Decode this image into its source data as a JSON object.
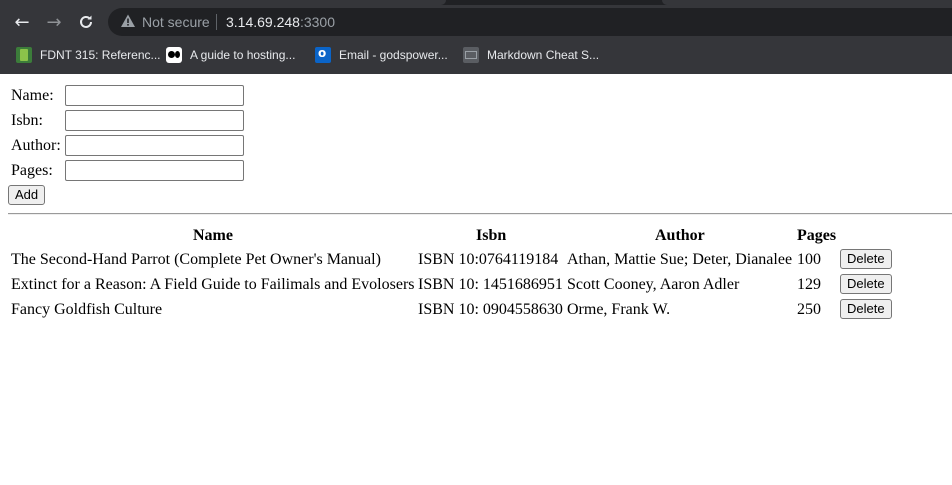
{
  "browser": {
    "security_label": "Not secure",
    "url_host": "3.14.69.248",
    "url_port": ":3300",
    "bookmarks": [
      {
        "label": "FDNT 315: Referenc...",
        "icon": "fdnt-favicon"
      },
      {
        "label": "A guide to hosting...",
        "icon": "medium-favicon"
      },
      {
        "label": "Email - godspower...",
        "icon": "outlook-favicon"
      },
      {
        "label": "Markdown Cheat S...",
        "icon": "markdown-favicon"
      }
    ]
  },
  "form": {
    "name_label": "Name:",
    "isbn_label": "Isbn:",
    "author_label": "Author:",
    "pages_label": "Pages:",
    "name_value": "",
    "isbn_value": "",
    "author_value": "",
    "pages_value": "",
    "add_label": "Add"
  },
  "table": {
    "headers": {
      "name": "Name",
      "isbn": "Isbn",
      "author": "Author",
      "pages": "Pages"
    },
    "delete_label": "Delete",
    "rows": [
      {
        "name": "The Second-Hand Parrot (Complete Pet Owner's Manual)",
        "isbn": "ISBN 10:0764119184",
        "author": "Athan, Mattie Sue; Deter, Dianalee",
        "pages": "100"
      },
      {
        "name": "Extinct for a Reason: A Field Guide to Failimals and Evolosers",
        "isbn": "ISBN 10: 1451686951",
        "author": "Scott Cooney, Aaron Adler",
        "pages": "129"
      },
      {
        "name": "Fancy Goldfish Culture",
        "isbn": "ISBN 10: 0904558630",
        "author": "Orme, Frank W.",
        "pages": "250"
      }
    ]
  }
}
